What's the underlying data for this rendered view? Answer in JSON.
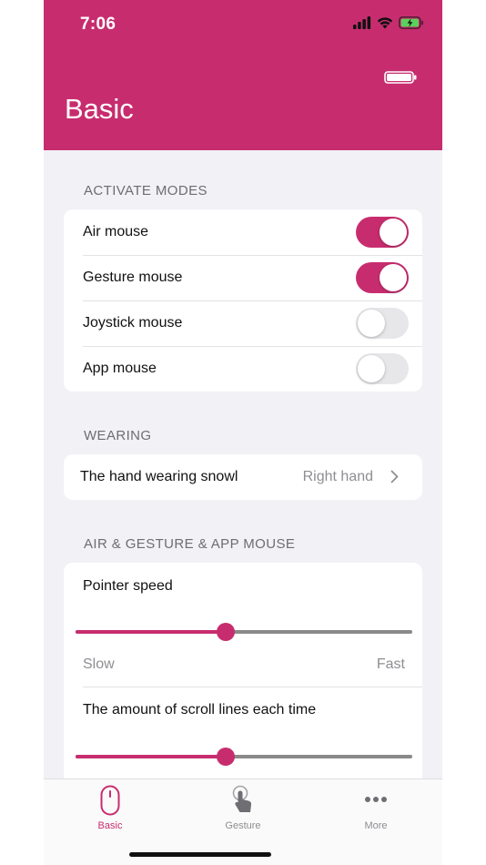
{
  "status_bar": {
    "time": "7:06"
  },
  "header": {
    "title": "Basic"
  },
  "activate_modes": {
    "header": "ACTIVATE MODES",
    "items": [
      {
        "label": "Air mouse",
        "on": true
      },
      {
        "label": "Gesture mouse",
        "on": true
      },
      {
        "label": "Joystick mouse",
        "on": false
      },
      {
        "label": "App mouse",
        "on": false
      }
    ]
  },
  "wearing": {
    "header": "WEARING",
    "label": "The hand wearing snowl",
    "value": "Right hand"
  },
  "air_gesture_app": {
    "header": "AIR & GESTURE & APP MOUSE",
    "pointer_speed": {
      "label": "Pointer speed",
      "value": 0.445,
      "min_label": "Slow",
      "max_label": "Fast"
    },
    "scroll_lines": {
      "label": "The amount of scroll lines each time",
      "value": 0.445
    }
  },
  "tabbar": {
    "tabs": [
      {
        "label": "Basic",
        "icon": "mouse-icon",
        "active": true
      },
      {
        "label": "Gesture",
        "icon": "hand-tap-icon",
        "active": false
      },
      {
        "label": "More",
        "icon": "more-dots-icon",
        "active": false
      }
    ]
  },
  "colors": {
    "accent": "#c72d6e",
    "background": "#f1f1f6",
    "toggle_off": "#e7e7ea",
    "secondary_text": "#8e8e93"
  }
}
